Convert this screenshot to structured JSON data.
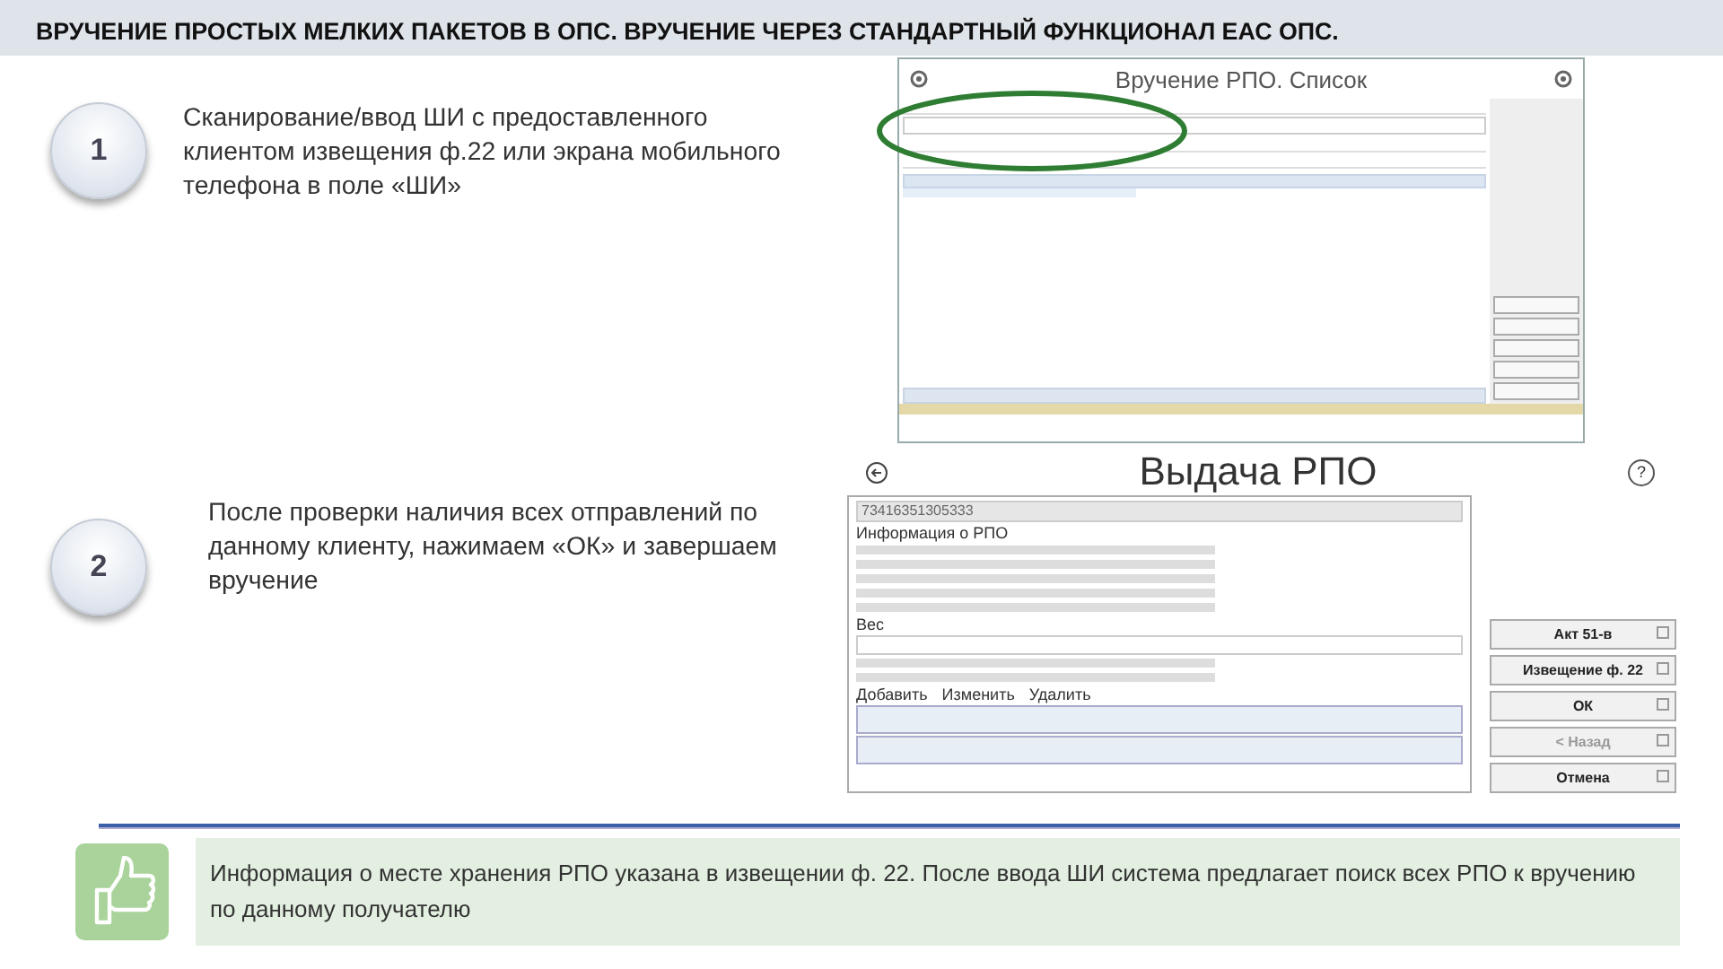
{
  "header": {
    "title": "ВРУЧЕНИЕ ПРОСТЫХ МЕЛКИХ ПАКЕТОВ В ОПС. ВРУЧЕНИЕ ЧЕРЕЗ СТАНДАРТНЫЙ ФУНКЦИОНАЛ ЕАС ОПС."
  },
  "steps": [
    {
      "number": "1",
      "text": "Сканирование/ввод ШИ с предоставленного клиентом извещения ф.22 или экрана мобильного телефона в поле «ШИ»"
    },
    {
      "number": "2",
      "text": "После проверки наличия всех отправлений по данному клиенту, нажимаем «ОК» и завершаем вручение"
    }
  ],
  "list_screen": {
    "title": "Вручение РПО. Список",
    "highlighted": true
  },
  "issue_screen": {
    "title": "Выдача РПО",
    "help_glyph": "?",
    "barcode_value": "73416351305333",
    "info_label": "Информация о РПО",
    "weight_label": "Вес",
    "services_actions": [
      "Добавить",
      "Изменить",
      "Удалить"
    ],
    "buttons": [
      {
        "label": "Акт 51-в",
        "disabled": false
      },
      {
        "label": "Извещение ф. 22",
        "disabled": false
      },
      {
        "label": "ОК",
        "disabled": false
      },
      {
        "label": "< Назад",
        "disabled": true
      },
      {
        "label": "Отмена",
        "disabled": false
      }
    ]
  },
  "note": {
    "text": "Информация о месте хранения РПО указана в извещении ф. 22.  После ввода ШИ система предлагает поиск всех РПО к вручению по данному получателю"
  }
}
